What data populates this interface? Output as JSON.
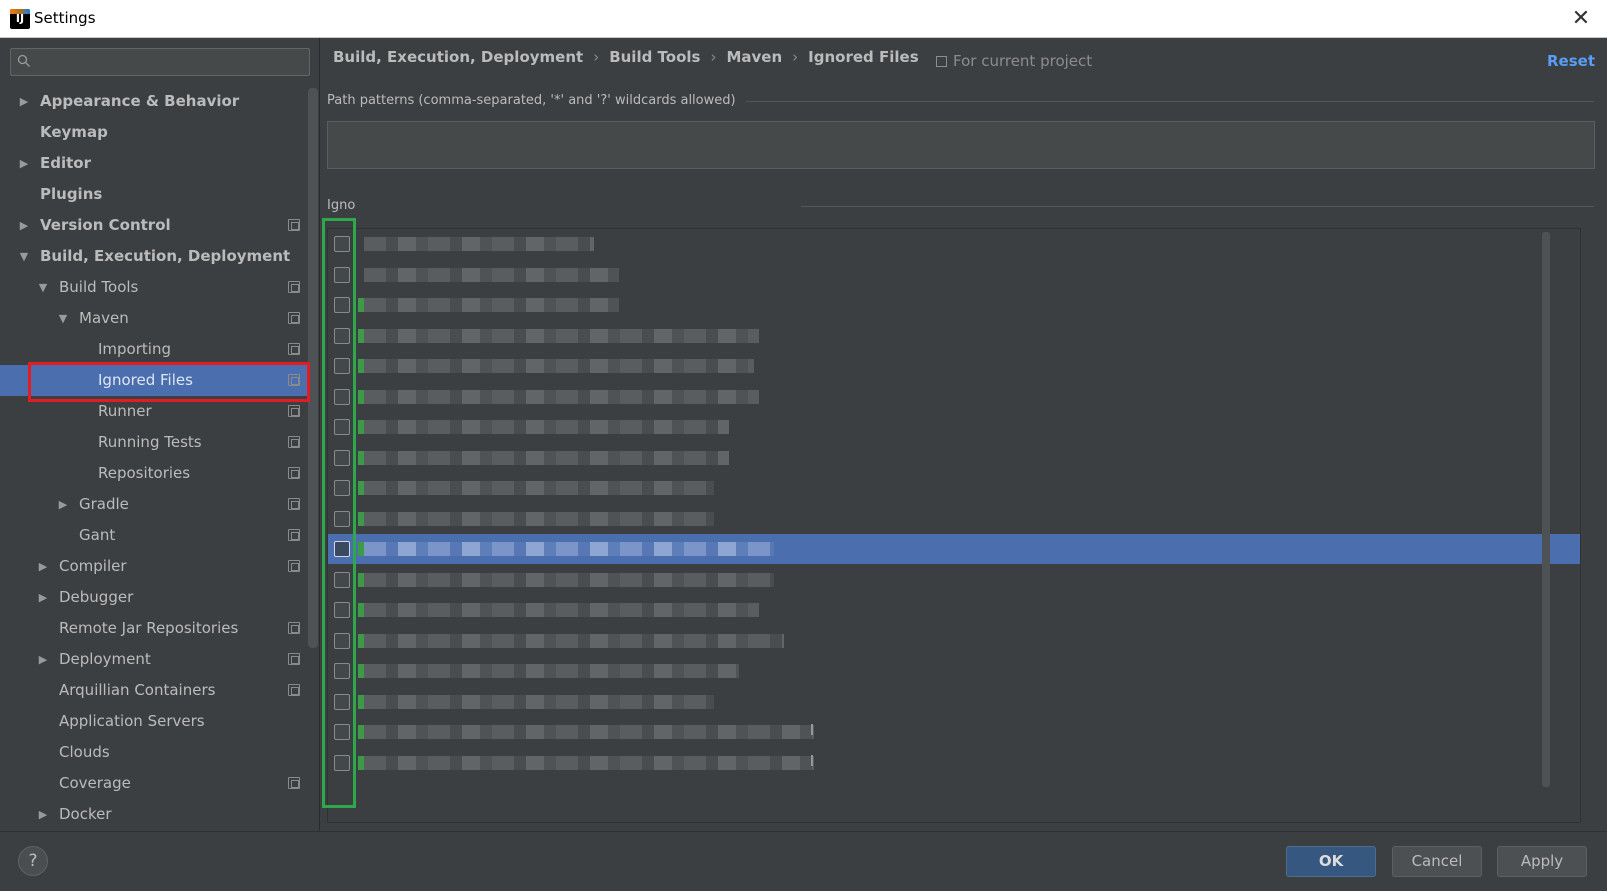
{
  "window": {
    "title": "Settings",
    "logo": "IJ",
    "close": "✕"
  },
  "sidebar": {
    "search": {
      "placeholder": "",
      "value": ""
    },
    "items": [
      {
        "label": "Appearance & Behavior",
        "level": 0,
        "arrow": "▶",
        "bold": true,
        "proj": false
      },
      {
        "label": "Keymap",
        "level": 0,
        "arrow": "",
        "bold": true,
        "proj": false
      },
      {
        "label": "Editor",
        "level": 0,
        "arrow": "▶",
        "bold": true,
        "proj": false
      },
      {
        "label": "Plugins",
        "level": 0,
        "arrow": "",
        "bold": true,
        "proj": false
      },
      {
        "label": "Version Control",
        "level": 0,
        "arrow": "▶",
        "bold": true,
        "proj": true
      },
      {
        "label": "Build, Execution, Deployment",
        "level": 0,
        "arrow": "▼",
        "bold": true,
        "proj": false
      },
      {
        "label": "Build Tools",
        "level": 1,
        "arrow": "▼",
        "bold": false,
        "proj": true
      },
      {
        "label": "Maven",
        "level": 2,
        "arrow": "▼",
        "bold": false,
        "proj": true
      },
      {
        "label": "Importing",
        "level": 3,
        "arrow": "",
        "bold": false,
        "proj": true
      },
      {
        "label": "Ignored Files",
        "level": 3,
        "arrow": "",
        "bold": false,
        "proj": true,
        "selected": true
      },
      {
        "label": "Runner",
        "level": 3,
        "arrow": "",
        "bold": false,
        "proj": true
      },
      {
        "label": "Running Tests",
        "level": 3,
        "arrow": "",
        "bold": false,
        "proj": true
      },
      {
        "label": "Repositories",
        "level": 3,
        "arrow": "",
        "bold": false,
        "proj": true
      },
      {
        "label": "Gradle",
        "level": 2,
        "arrow": "▶",
        "bold": false,
        "proj": true
      },
      {
        "label": "Gant",
        "level": 2,
        "arrow": "",
        "bold": false,
        "proj": true
      },
      {
        "label": "Compiler",
        "level": 1,
        "arrow": "▶",
        "bold": false,
        "proj": true
      },
      {
        "label": "Debugger",
        "level": 1,
        "arrow": "▶",
        "bold": false,
        "proj": false
      },
      {
        "label": "Remote Jar Repositories",
        "level": 1,
        "arrow": "",
        "bold": false,
        "proj": true
      },
      {
        "label": "Deployment",
        "level": 1,
        "arrow": "▶",
        "bold": false,
        "proj": true
      },
      {
        "label": "Arquillian Containers",
        "level": 1,
        "arrow": "",
        "bold": false,
        "proj": true
      },
      {
        "label": "Application Servers",
        "level": 1,
        "arrow": "",
        "bold": false,
        "proj": false
      },
      {
        "label": "Clouds",
        "level": 1,
        "arrow": "",
        "bold": false,
        "proj": false
      },
      {
        "label": "Coverage",
        "level": 1,
        "arrow": "",
        "bold": false,
        "proj": true
      },
      {
        "label": "Docker",
        "level": 1,
        "arrow": "▶",
        "bold": false,
        "proj": false
      }
    ]
  },
  "main": {
    "breadcrumb": [
      "Build, Execution, Deployment",
      "Build Tools",
      "Maven",
      "Ignored Files"
    ],
    "breadcrumb_sep": "›",
    "for_project": "For current project",
    "reset": "Reset",
    "patterns_label": "Path patterns (comma-separated, '*' and '?' wildcards allowed)",
    "patterns_value": "",
    "ignored_label": "Igno",
    "ignored_files": {
      "row_count": 18,
      "selected_index": 10,
      "checked": false,
      "suffix_rows": [
        {
          "index": 16,
          "text": "l"
        },
        {
          "index": 17,
          "text": "l"
        }
      ]
    }
  },
  "footer": {
    "help": "?",
    "ok": "OK",
    "cancel": "Cancel",
    "apply": "Apply"
  },
  "colors": {
    "selection": "#4b6eaf",
    "link": "#589df6",
    "highlight_red": "#e31c23",
    "highlight_green": "#2ea84a",
    "ok_button": "#365880"
  }
}
